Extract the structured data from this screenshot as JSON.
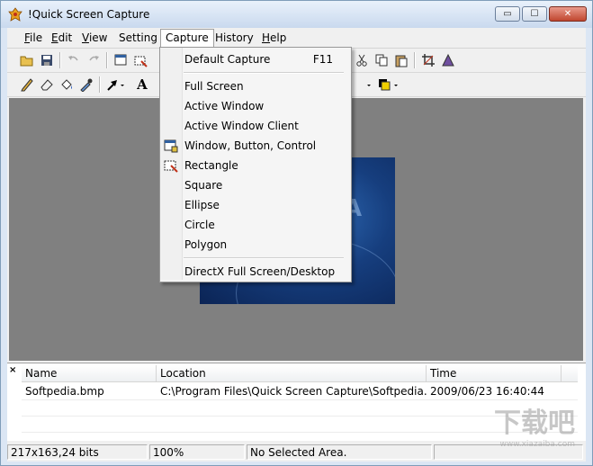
{
  "window": {
    "title": "!Quick Screen Capture",
    "controls": {
      "minimize": "▭",
      "maximize": "☐",
      "close": "✕"
    }
  },
  "menubar": {
    "items": [
      {
        "label": "File",
        "key": "F",
        "rest": "ile"
      },
      {
        "label": "Edit",
        "key": "E",
        "rest": "dit"
      },
      {
        "label": "View",
        "key": "V",
        "rest": "iew"
      },
      {
        "label": "Setting",
        "key": "",
        "rest": "Setting"
      },
      {
        "label": "Capture",
        "key": "",
        "rest": "Capture"
      },
      {
        "label": "History",
        "key": "",
        "rest": "History"
      },
      {
        "label": "Help",
        "key": "H",
        "rest": "elp"
      }
    ]
  },
  "capture_menu": {
    "items": [
      {
        "label": "Default Capture",
        "shortcut": "F11"
      },
      {
        "label": "Full Screen"
      },
      {
        "label": "Active Window"
      },
      {
        "label": "Active Window Client"
      },
      {
        "label": "Window, Button, Control"
      },
      {
        "label": "Rectangle"
      },
      {
        "label": "Square"
      },
      {
        "label": "Ellipse"
      },
      {
        "label": "Circle"
      },
      {
        "label": "Polygon"
      },
      {
        "label": "DirectX Full Screen/Desktop"
      }
    ]
  },
  "file_list": {
    "close_label": "×",
    "columns": [
      "Name",
      "Location",
      "Time"
    ],
    "rows": [
      {
        "name": "Softpedia.bmp",
        "location": "C:\\Program Files\\Quick Screen Capture\\Softpedia.b...",
        "time": "2009/06/23 16:40:44"
      }
    ]
  },
  "statusbar": {
    "image_info": "217x163,24 bits",
    "zoom": "100%",
    "selection": "No Selected Area."
  },
  "watermark": {
    "image_text": "A",
    "logo_main": "下载吧",
    "logo_sub": "www.xiazaiba.com"
  },
  "colors": {
    "canvas": "#808080",
    "accent": "#dbe6f4",
    "close": "#c0462f"
  }
}
